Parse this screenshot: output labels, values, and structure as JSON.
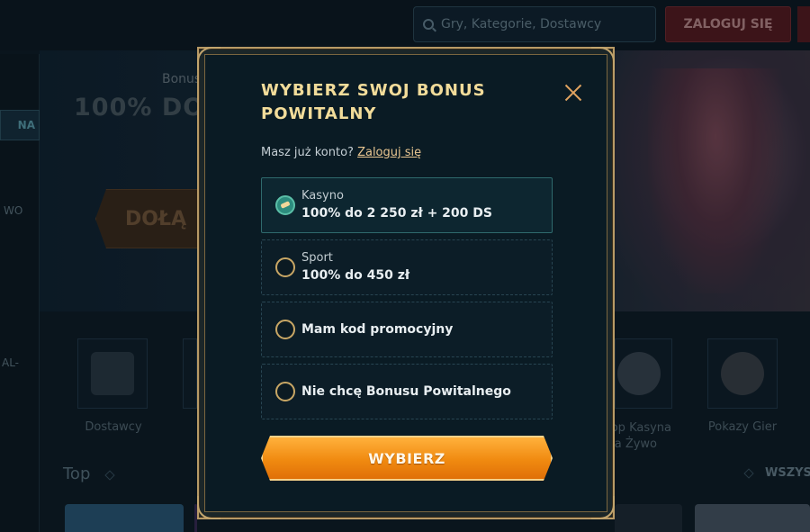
{
  "header": {
    "search_placeholder": "Gry, Kategorie, Dostawcy",
    "login_label": "ZALOGUJ SIĘ"
  },
  "sidebar": {
    "active_label": "NA",
    "item_wo": "WO",
    "item_al": "AL-"
  },
  "hero": {
    "bonus_label": "Bonus",
    "headline": "100% DO",
    "join_button": "DOŁĄ"
  },
  "categories": {
    "dostawcy": "Dostawcy",
    "top_kasyna": "Top Kasyna Na Żywo",
    "pokazy": "Pokazy Gier"
  },
  "top_section": {
    "title": "Top",
    "see_all": "WSZYST"
  },
  "modal": {
    "title": "WYBIERZ SWOJ BONUS POWITALNY",
    "account_question": "Masz już konto?",
    "login_link": "Zaloguj się",
    "options": [
      {
        "label": "Kasyno",
        "value": "100% do 2 250 zł + 200 DS",
        "selected": true
      },
      {
        "label": "Sport",
        "value": "100% do 450 zł",
        "selected": false
      },
      {
        "label": "Mam kod promocyjny",
        "selected": false
      },
      {
        "label": "Nie chcę Bonusu Powitalnego",
        "selected": false
      }
    ],
    "submit_label": "WYBIERZ"
  },
  "colors": {
    "accent_gold": "#f2dc9a",
    "button_orange": "#f08a10",
    "modal_bg": "#0a1b24",
    "selected_teal": "#2d8c7e"
  }
}
